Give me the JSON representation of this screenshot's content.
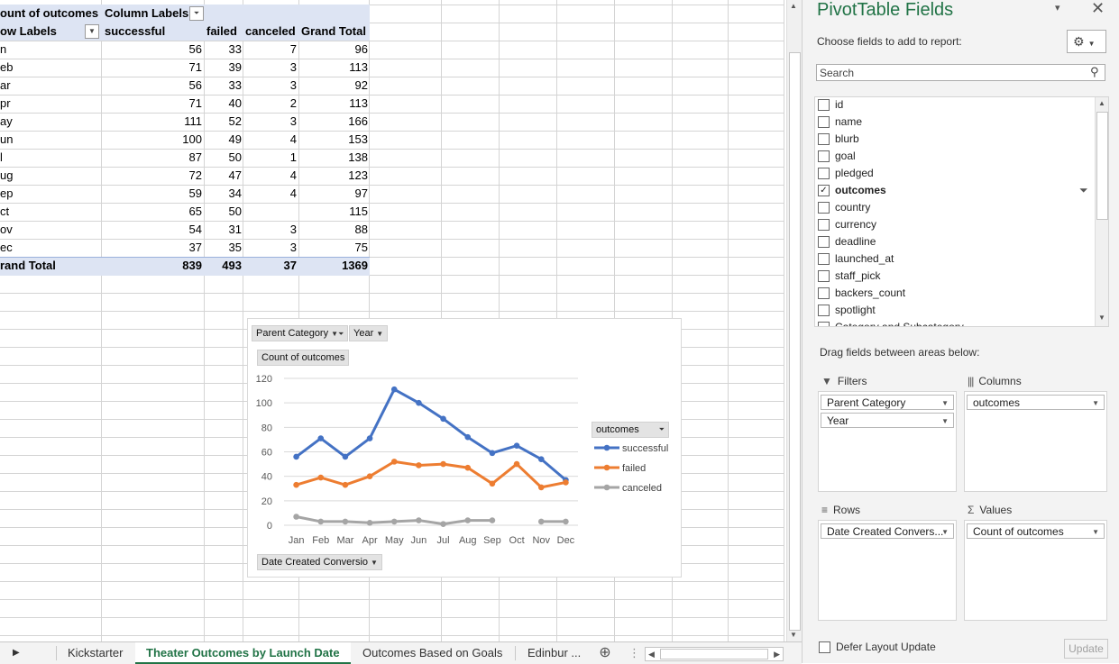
{
  "pivot_table": {
    "corner_label": "ount of outcomes",
    "column_labels_header": "Column Labels",
    "row_labels_header": "ow Labels",
    "column_headers": [
      "successful",
      "failed",
      "canceled",
      "Grand Total"
    ],
    "rows": [
      {
        "label": "n",
        "successful": "56",
        "failed": "33",
        "canceled": "7",
        "total": "96"
      },
      {
        "label": "eb",
        "successful": "71",
        "failed": "39",
        "canceled": "3",
        "total": "113"
      },
      {
        "label": "ar",
        "successful": "56",
        "failed": "33",
        "canceled": "3",
        "total": "92"
      },
      {
        "label": "pr",
        "successful": "71",
        "failed": "40",
        "canceled": "2",
        "total": "113"
      },
      {
        "label": "ay",
        "successful": "111",
        "failed": "52",
        "canceled": "3",
        "total": "166"
      },
      {
        "label": "un",
        "successful": "100",
        "failed": "49",
        "canceled": "4",
        "total": "153"
      },
      {
        "label": "l",
        "successful": "87",
        "failed": "50",
        "canceled": "1",
        "total": "138"
      },
      {
        "label": "ug",
        "successful": "72",
        "failed": "47",
        "canceled": "4",
        "total": "123"
      },
      {
        "label": "ep",
        "successful": "59",
        "failed": "34",
        "canceled": "4",
        "total": "97"
      },
      {
        "label": "ct",
        "successful": "65",
        "failed": "50",
        "canceled": "",
        "total": "115"
      },
      {
        "label": "ov",
        "successful": "54",
        "failed": "31",
        "canceled": "3",
        "total": "88"
      },
      {
        "label": "ec",
        "successful": "37",
        "failed": "35",
        "canceled": "3",
        "total": "75"
      }
    ],
    "grand_total": {
      "label": "rand Total",
      "successful": "839",
      "failed": "493",
      "canceled": "37",
      "total": "1369"
    }
  },
  "chart": {
    "filter_buttons": [
      "Parent Category",
      "Year"
    ],
    "value_button": "Count of outcomes",
    "axis_button": "Date Created Conversio",
    "legend_button": "outcomes"
  },
  "chart_data": {
    "type": "line",
    "categories": [
      "Jan",
      "Feb",
      "Mar",
      "Apr",
      "May",
      "Jun",
      "Jul",
      "Aug",
      "Sep",
      "Oct",
      "Nov",
      "Dec"
    ],
    "series": [
      {
        "name": "successful",
        "color": "#4472c4",
        "values": [
          56,
          71,
          56,
          71,
          111,
          100,
          87,
          72,
          59,
          65,
          54,
          37
        ]
      },
      {
        "name": "failed",
        "color": "#ed7d31",
        "values": [
          33,
          39,
          33,
          40,
          52,
          49,
          50,
          47,
          34,
          50,
          31,
          35
        ]
      },
      {
        "name": "canceled",
        "color": "#a5a5a5",
        "values": [
          7,
          3,
          3,
          2,
          3,
          4,
          1,
          4,
          4,
          null,
          3,
          3
        ]
      }
    ],
    "yticks": [
      "0",
      "20",
      "40",
      "60",
      "80",
      "100",
      "120"
    ],
    "ylim": [
      0,
      120
    ],
    "grid": true,
    "legend_position": "right"
  },
  "sheet_tabs": {
    "tabs": [
      "Kickstarter",
      "Theater Outcomes by Launch Date",
      "Outcomes Based on Goals",
      "Edinbur ..."
    ],
    "active_index": 1
  },
  "pivot_pane": {
    "title": "PivotTable Fields",
    "choose_label": "Choose fields to add to report:",
    "search_placeholder": "Search",
    "fields": [
      {
        "name": "id",
        "checked": false
      },
      {
        "name": "name",
        "checked": false
      },
      {
        "name": "blurb",
        "checked": false
      },
      {
        "name": "goal",
        "checked": false
      },
      {
        "name": "pledged",
        "checked": false
      },
      {
        "name": "outcomes",
        "checked": true
      },
      {
        "name": "country",
        "checked": false
      },
      {
        "name": "currency",
        "checked": false
      },
      {
        "name": "deadline",
        "checked": false
      },
      {
        "name": "launched_at",
        "checked": false
      },
      {
        "name": "staff_pick",
        "checked": false
      },
      {
        "name": "backers_count",
        "checked": false
      },
      {
        "name": "spotlight",
        "checked": false
      },
      {
        "name": "Category and Subcategory",
        "checked": false
      }
    ],
    "drag_label": "Drag fields between areas below:",
    "areas": {
      "filters": {
        "title": "Filters",
        "items": [
          "Parent Category",
          "Year"
        ]
      },
      "columns": {
        "title": "Columns",
        "items": [
          "outcomes"
        ]
      },
      "rows": {
        "title": "Rows",
        "items": [
          "Date Created Convers..."
        ]
      },
      "values": {
        "title": "Values",
        "items": [
          "Count of outcomes"
        ]
      }
    },
    "defer_label": "Defer Layout Update",
    "update_label": "Update"
  }
}
